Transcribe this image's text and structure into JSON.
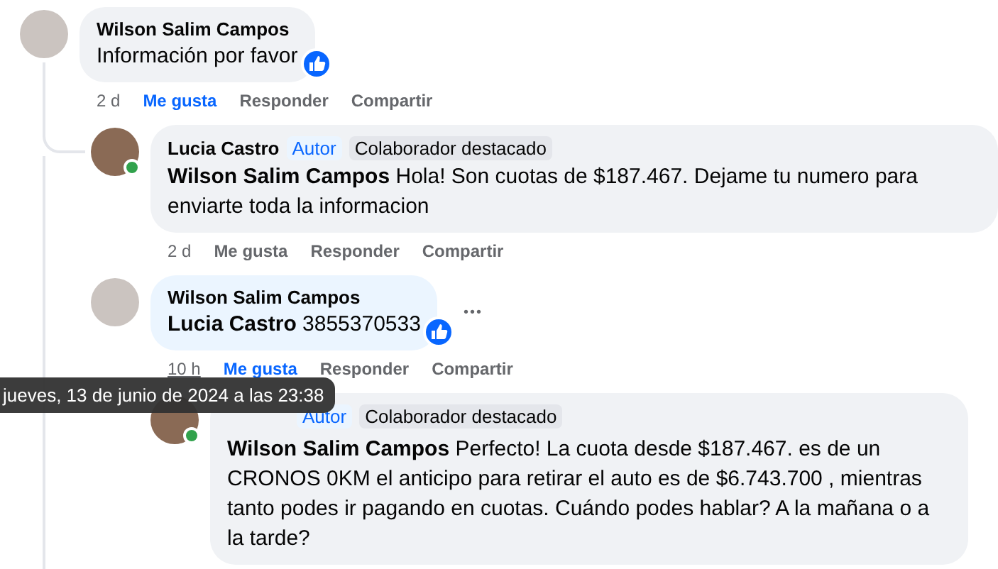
{
  "comments": [
    {
      "author": "Wilson Salim Campos",
      "text": "Información por favor",
      "reaction": true,
      "time": "2 d",
      "actions": [
        {
          "label": "Me gusta",
          "selected": true
        },
        {
          "label": "Responder",
          "selected": false
        },
        {
          "label": "Compartir",
          "selected": false
        }
      ],
      "replies": [
        {
          "author": "Lucia Castro",
          "badges": [
            {
              "label": "Autor",
              "kind": "author"
            },
            {
              "label": "Colaborador destacado",
              "kind": "top"
            }
          ],
          "text": "**Wilson Salim Campos** Hola! Son cuotas de $187.467. Dejame tu numero para enviarte toda la informacion",
          "online": true,
          "time": "2 d",
          "actions": [
            {
              "label": "Me gusta",
              "selected": false
            },
            {
              "label": "Responder",
              "selected": false
            },
            {
              "label": "Compartir",
              "selected": false
            }
          ]
        },
        {
          "author": "Wilson Salim Campos",
          "text": "**Lucia Castro** 3855370533",
          "reaction": true,
          "highlighted": true,
          "time": "10 h",
          "time_hovered": true,
          "actions": [
            {
              "label": "Me gusta",
              "selected": true
            },
            {
              "label": "Responder",
              "selected": false
            },
            {
              "label": "Compartir",
              "selected": false
            }
          ],
          "more": "•••",
          "replies": [
            {
              "badges": [
                {
                  "label": "Autor",
                  "kind": "author"
                },
                {
                  "label": "Colaborador destacado",
                  "kind": "top"
                }
              ],
              "text": "**Wilson Salim Campos** Perfecto! La cuota desde $187.467. es de un CRONOS 0KM el anticipo para retirar el auto es de $6.743.700 , mientras tanto podes ir pagando en cuotas. Cuándo podes hablar? A la mañana o a la tarde?",
              "online": true
            }
          ]
        }
      ]
    }
  ],
  "tooltip": "jueves, 13 de junio de 2024 a las 23:38"
}
